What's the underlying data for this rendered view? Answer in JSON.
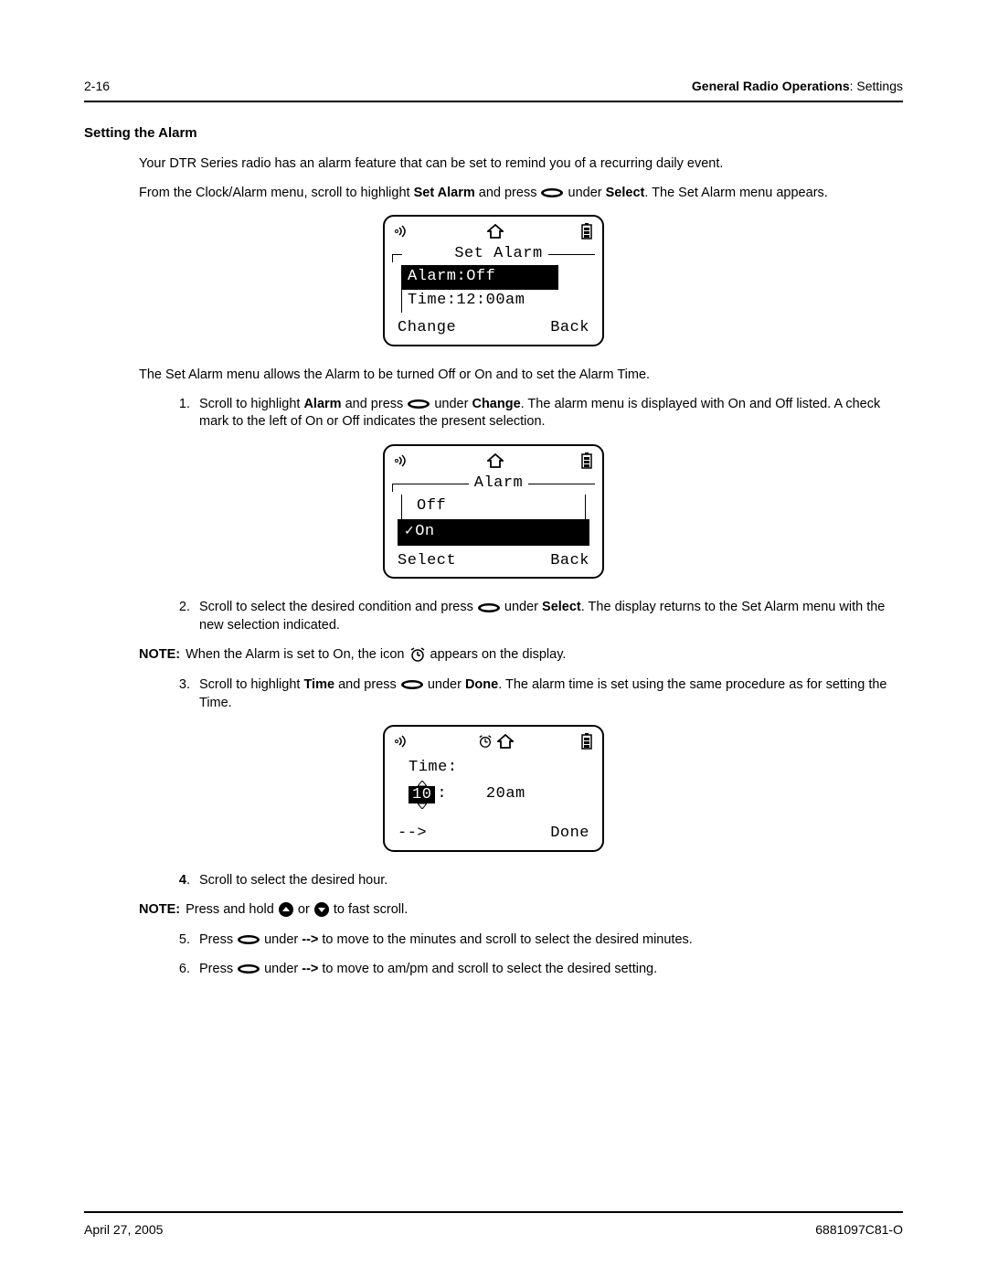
{
  "header": {
    "page_num": "2-16",
    "section_bold": "General Radio Operations",
    "section_rest": ": Settings"
  },
  "heading": "Setting the Alarm",
  "p1": "Your DTR Series radio has an alarm feature that can be set to remind you of a recurring daily event.",
  "p2a": "From the Clock/Alarm menu, scroll to highlight ",
  "p2b": "Set Alarm",
  "p2c": " and press ",
  "p2d": " under ",
  "p2e": "Select",
  "p2f": ". The Set Alarm menu appears.",
  "lcd1": {
    "title": "Set Alarm",
    "row1": "Alarm:Off",
    "row2": "Time:12:00am",
    "left": "Change",
    "right": "Back"
  },
  "p3": "The Set Alarm menu allows the Alarm to be turned Off or On and to set the Alarm Time.",
  "step1": {
    "num": "1.",
    "a": "Scroll to highlight ",
    "b": "Alarm",
    "c": " and press ",
    "d": " under ",
    "e": "Change",
    "f": ". The alarm menu is displayed with On and Off listed. A check mark to the left of On or Off indicates the present selection."
  },
  "lcd2": {
    "title": "Alarm",
    "row1": "Off",
    "row2": "On",
    "check": "✓",
    "left": "Select",
    "right": "Back"
  },
  "step2": {
    "num": "2.",
    "a": "Scroll to select the desired condition and press ",
    "b": " under ",
    "c": "Select",
    "d": ". The display returns to the Set Alarm menu with the new selection indicated."
  },
  "note1": {
    "label": "NOTE:",
    "a": "When the Alarm is set to On, the icon ",
    "b": " appears on the display."
  },
  "step3": {
    "num": "3.",
    "a": "Scroll to highlight ",
    "b": "Time",
    "c": " and press ",
    "d": " under ",
    "e": "Done",
    "f": ". The alarm time is set using the same procedure as for setting the Time."
  },
  "lcd3": {
    "title": "Time:",
    "hour": "10",
    "rest": ":    20am",
    "left": "-->",
    "right": "Done"
  },
  "step4": {
    "num": "4",
    "dot": ".",
    "text": "Scroll to select the desired hour."
  },
  "note2": {
    "label": "NOTE:",
    "a": "Press and hold ",
    "b": " or ",
    "c": " to fast scroll."
  },
  "step5": {
    "num": "5.",
    "a": "Press ",
    "b": " under ",
    "c": "-->",
    "d": " to move to the minutes and scroll to select the desired minutes."
  },
  "step6": {
    "num": "6.",
    "a": "Press ",
    "b": " under ",
    "c": "-->",
    "d": " to move to am/pm and scroll to select the desired setting."
  },
  "footer": {
    "date": "April 27, 2005",
    "docnum": "6881097C81-O"
  }
}
